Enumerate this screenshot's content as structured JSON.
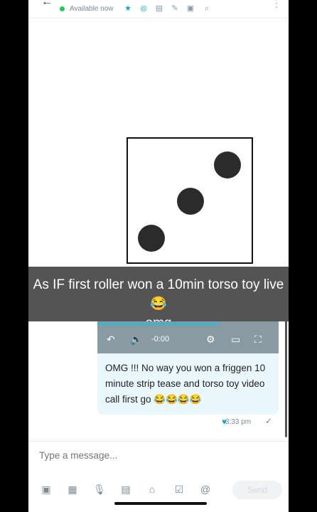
{
  "header": {
    "back_icon": "arrow-left-icon",
    "status": "Available now",
    "icons": [
      "star-icon",
      "bell-icon",
      "note-icon",
      "pin-icon",
      "image-icon",
      "search-icon",
      "more-icon"
    ]
  },
  "caption": {
    "line1": "As IF first roller won a 10min torso toy live 😂",
    "line2": "omg"
  },
  "video": {
    "time": "-0:00",
    "progress_fraction": 0.67
  },
  "message": {
    "text": "OMG !!! No way you won a friggen 10 minute strip tease and torso toy video call first go 😂😂😂😂",
    "time": "3:33 pm"
  },
  "composer": {
    "placeholder": "Type a message..."
  },
  "toolbar": {
    "icons": [
      "image-icon",
      "gif-icon",
      "mic-icon",
      "media-icon",
      "tag-icon",
      "calendar-icon",
      "mention-icon"
    ],
    "send_label": "Send"
  },
  "colors": {
    "accent": "#12a7c9",
    "online": "#23c55e",
    "bubble": "#eaf7fc"
  }
}
